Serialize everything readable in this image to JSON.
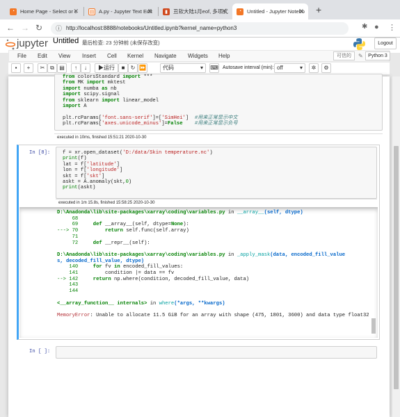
{
  "browser": {
    "tabs": [
      {
        "title": "Home Page - Select or c"
      },
      {
        "title": "A.py - Jupyter Text Edit"
      },
      {
        "title": "丑软大陆1月eof, 多项式"
      },
      {
        "title": "Untitled - Jupyter Notebo"
      }
    ],
    "url": "http://localhost:8888/notebooks/Untitled.ipynb?kernel_name=python3"
  },
  "jupyter": {
    "logo": "jupyter",
    "notebook_name": "Untitled",
    "checkpoint": "最后检查: 23 分钟前 (未保存改变)",
    "logout": "Logout",
    "menu": [
      "File",
      "Edit",
      "View",
      "Insert",
      "Cell",
      "Kernel",
      "Navigate",
      "Widgets",
      "Help"
    ],
    "trusted": "可信的",
    "kernel": "Python 3",
    "toolbar": {
      "run": "运行",
      "cell_type": "代码",
      "autosave_label": "Autosave interval (min):",
      "autosave_value": "off"
    }
  },
  "cells": {
    "cell1_exec": "executed in 10ms, finished 15:51:21 2020-10-30",
    "cell2_prompt": "In  [8]:",
    "cell2_exec": "executed in 1m 15.8s, finished 15:58:25 2020-10-30",
    "cell3_prompt": "In  [ ]:",
    "error": {
      "file1": "D:\\Anadonda\\lib\\site-packages\\xarray\\coding\\variables.py",
      "in1": "in",
      "func1": "__array__",
      "sig1": "(self, dtype)",
      "file2": "D:\\Anadonda\\lib\\site-packages\\xarray\\coding\\variables.py",
      "func2": "_apply_mask",
      "sig2a": "(data, encoded_fill_value",
      "sig2b": "s, decoded_fill_value, dtype)",
      "array_fn": "<__array_function__ internals>",
      "where_fn": "where",
      "where_sig": "(*args, **kwargs)",
      "error_name": "MemoryError",
      "error_msg": ": Unable to allocate 11.5 GiB for an array with shape (475, 1801, 3600) and data type float32"
    }
  },
  "icons": [
    "new-tab-icon",
    "back-icon",
    "forward-icon",
    "reload-icon",
    "lock-icon",
    "extensions-icon",
    "profile-icon",
    "menu-icon",
    "python-logo-icon"
  ]
}
